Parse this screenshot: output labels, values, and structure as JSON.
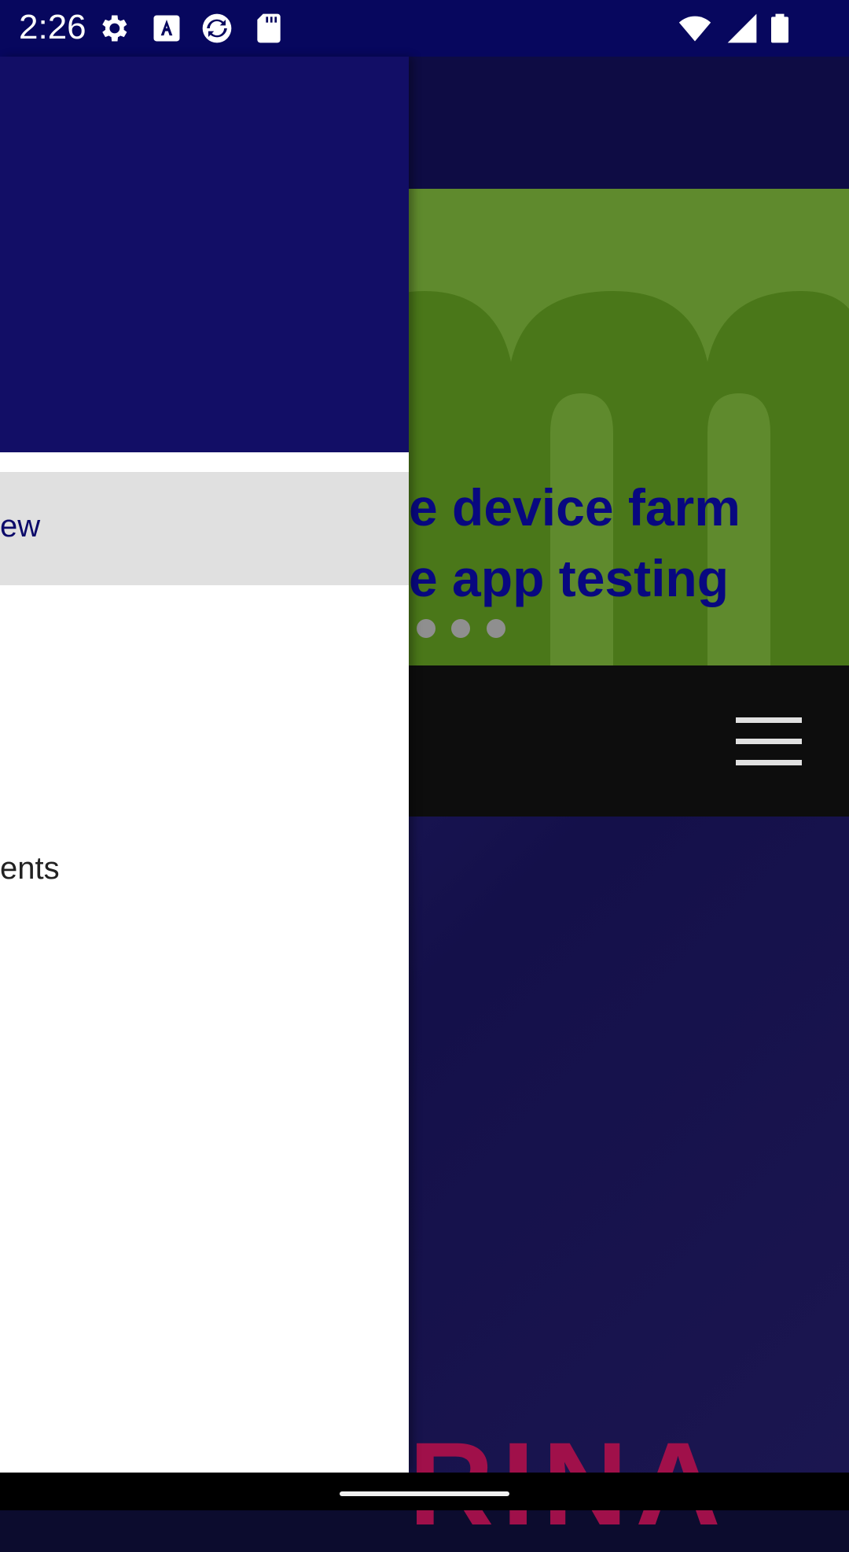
{
  "status_bar": {
    "time": "2:26",
    "left_icons": [
      "gear-icon",
      "font-a-icon",
      "refresh-circle-icon",
      "sd-card-icon"
    ],
    "right_icons": [
      "wifi-icon",
      "signal-icon",
      "battery-icon"
    ]
  },
  "hero": {
    "line1": "e device farm",
    "line2": "e app testing",
    "carousel_dots": 3
  },
  "drawer": {
    "selected_item_label": "ew",
    "item2_label": "ents"
  },
  "lower": {
    "brand_text": "RINA"
  },
  "colors": {
    "status_bar": "#07075e",
    "drawer_header": "#120e66",
    "hero_bg": "#5f8a2d",
    "hero_text": "#080880",
    "selected_item_bg": "#e0e0e0",
    "nav_bar": "#0d0d0d",
    "brand_accent": "#a0104a"
  }
}
